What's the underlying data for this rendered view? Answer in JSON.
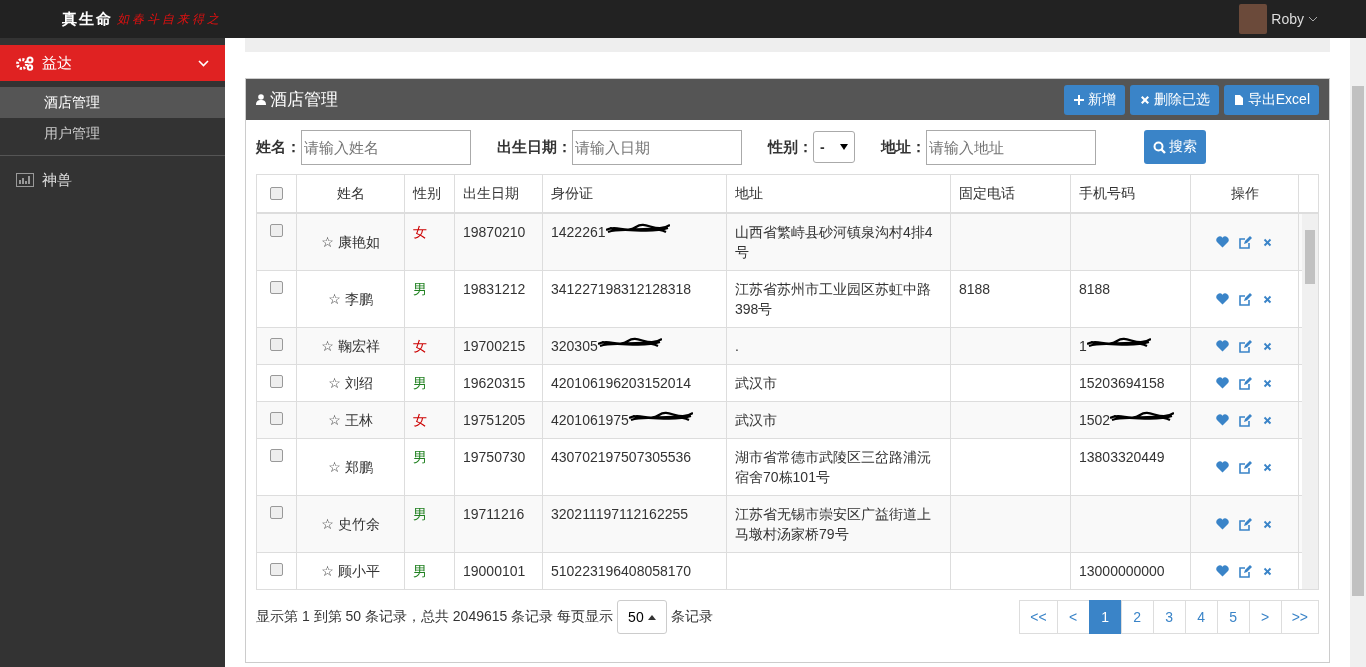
{
  "header": {
    "logo": "真生命",
    "slogan": "如春斗自来得之",
    "user": "Roby"
  },
  "sidebar": {
    "items": [
      {
        "label": "益达",
        "expanded": true,
        "children": [
          {
            "label": "酒店管理",
            "selected": true
          },
          {
            "label": "用户管理",
            "selected": false
          }
        ]
      },
      {
        "label": "神兽",
        "expanded": false
      }
    ]
  },
  "panel": {
    "title": "酒店管理",
    "buttons": [
      {
        "label": "新增"
      },
      {
        "label": "删除已选"
      },
      {
        "label": "导出Excel"
      }
    ]
  },
  "filters": [
    {
      "kind": "text",
      "label": "姓名：",
      "placeholder": "请输入姓名"
    },
    {
      "kind": "text",
      "label": "出生日期：",
      "placeholder": "请输入日期"
    },
    {
      "kind": "select",
      "label": "性别：",
      "value": "-"
    },
    {
      "kind": "text",
      "label": "地址：",
      "placeholder": "请输入地址"
    }
  ],
  "search_button": "搜索",
  "table": {
    "all_checked": false,
    "columns": [
      "姓名",
      "性别",
      "出生日期",
      "身份证",
      "地址",
      "固定电话",
      "手机号码",
      "操作"
    ],
    "rows": [
      {
        "checked": false,
        "name": "☆ 康艳如",
        "gender": "女",
        "color": "#cc0000",
        "birth": "19870210",
        "id": "1422261",
        "id_redacted": true,
        "address": "山西省繁峙县砂河镇泉沟村4排4号",
        "mobile_redacted": false
      },
      {
        "checked": false,
        "name": "☆ 李鹏",
        "gender": "男",
        "color": "#208020",
        "birth": "19831212",
        "id": "341227198312128318",
        "id_redacted": false,
        "address": "江苏省苏州市工业园区苏虹中路398号",
        "phone": "8188",
        "mobile": "8188",
        "mobile_redacted": false
      },
      {
        "checked": false,
        "name": "☆ 鞠宏祥",
        "gender": "女",
        "color": "#cc0000",
        "birth": "19700215",
        "id": "320305",
        "id_redacted": true,
        "address": ".",
        "mobile": "1",
        "mobile_redacted": true
      },
      {
        "checked": false,
        "name": "☆ 刘绍",
        "gender": "男",
        "color": "#208020",
        "birth": "19620315",
        "id": "420106196203152014",
        "id_redacted": false,
        "address": "武汉市",
        "mobile": "15203694158",
        "mobile_redacted": false
      },
      {
        "checked": false,
        "name": "☆ 王林",
        "gender": "女",
        "color": "#cc0000",
        "birth": "19751205",
        "id": "4201061975",
        "id_redacted": true,
        "address": "武汉市",
        "mobile": "1502",
        "mobile_redacted": true
      },
      {
        "checked": false,
        "name": "☆ 郑鹏",
        "gender": "男",
        "color": "#208020",
        "birth": "19750730",
        "id": "430702197507305536",
        "id_redacted": false,
        "address": "湖市省常德市武陵区三岔路浦沅宿舍70栋101号",
        "mobile": "13803320449",
        "mobile_redacted": false
      },
      {
        "checked": false,
        "name": "☆ 史竹余",
        "gender": "男",
        "color": "#208020",
        "birth": "19711216",
        "id": "320211197112162255",
        "id_redacted": false,
        "address": "江苏省无锡市崇安区广益街道上马墩村汤家桥79号",
        "mobile_redacted": false
      },
      {
        "checked": false,
        "name": "☆ 顾小平",
        "gender": "男",
        "color": "#208020",
        "birth": "19000101",
        "id": "510223196408058170",
        "id_redacted": false,
        "mobile": "13000000000",
        "mobile_redacted": false
      }
    ]
  },
  "footer": {
    "summary": "显示第 1 到第 50 条记录，总共 2049615 条记录 每页显示",
    "page_size": "50",
    "suffix": "条记录"
  },
  "pagination": [
    {
      "label": "<<",
      "selected": false
    },
    {
      "label": "<",
      "selected": false
    },
    {
      "label": "1",
      "selected": true
    },
    {
      "label": "2",
      "selected": false
    },
    {
      "label": "3",
      "selected": false
    },
    {
      "label": "4",
      "selected": false
    },
    {
      "label": "5",
      "selected": false
    },
    {
      "label": ">",
      "selected": false
    },
    {
      "label": ">>",
      "selected": false
    }
  ]
}
